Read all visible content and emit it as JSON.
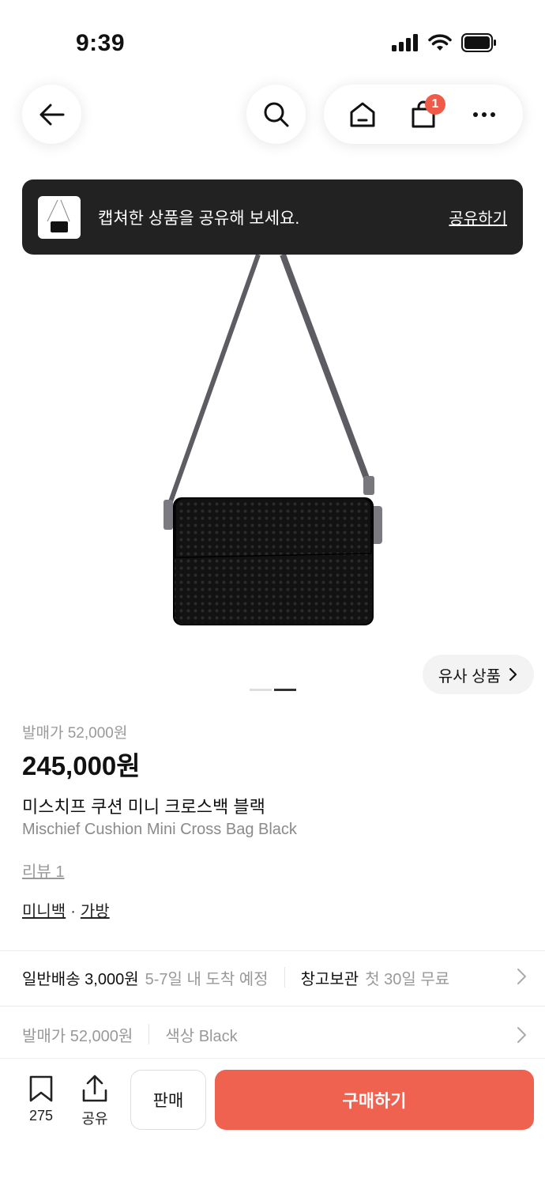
{
  "status_bar": {
    "time": "9:39"
  },
  "header": {
    "cart_badge": "1"
  },
  "toast": {
    "message": "캡쳐한 상품을 공유해 보세요.",
    "action": "공유하기"
  },
  "gallery": {
    "similar_label": "유사 상품",
    "page_count": 2,
    "active_page": 2
  },
  "product": {
    "release_price": "발매가 52,000원",
    "price": "245,000원",
    "name_ko": "미스치프 쿠션 미니 크로스백 블랙",
    "name_en": "Mischief Cushion Mini Cross Bag Black",
    "review": "리뷰 1",
    "categories": [
      "미니백",
      "가방"
    ],
    "category_separator": "·"
  },
  "shipping": {
    "standard_label": "일반배송 3,000원",
    "standard_eta": "5-7일 내 도착 예정",
    "warehouse_label": "창고보관",
    "warehouse_desc": "첫 30일 무료"
  },
  "options": {
    "release_price": "발매가 52,000원",
    "color": "색상 Black"
  },
  "bottom_bar": {
    "wish_count": "275",
    "share_label": "공유",
    "sell_label": "판매",
    "buy_label": "구매하기"
  },
  "colors": {
    "accent": "#ef6250",
    "badge": "#ef5b48",
    "toast_bg": "#222222"
  }
}
